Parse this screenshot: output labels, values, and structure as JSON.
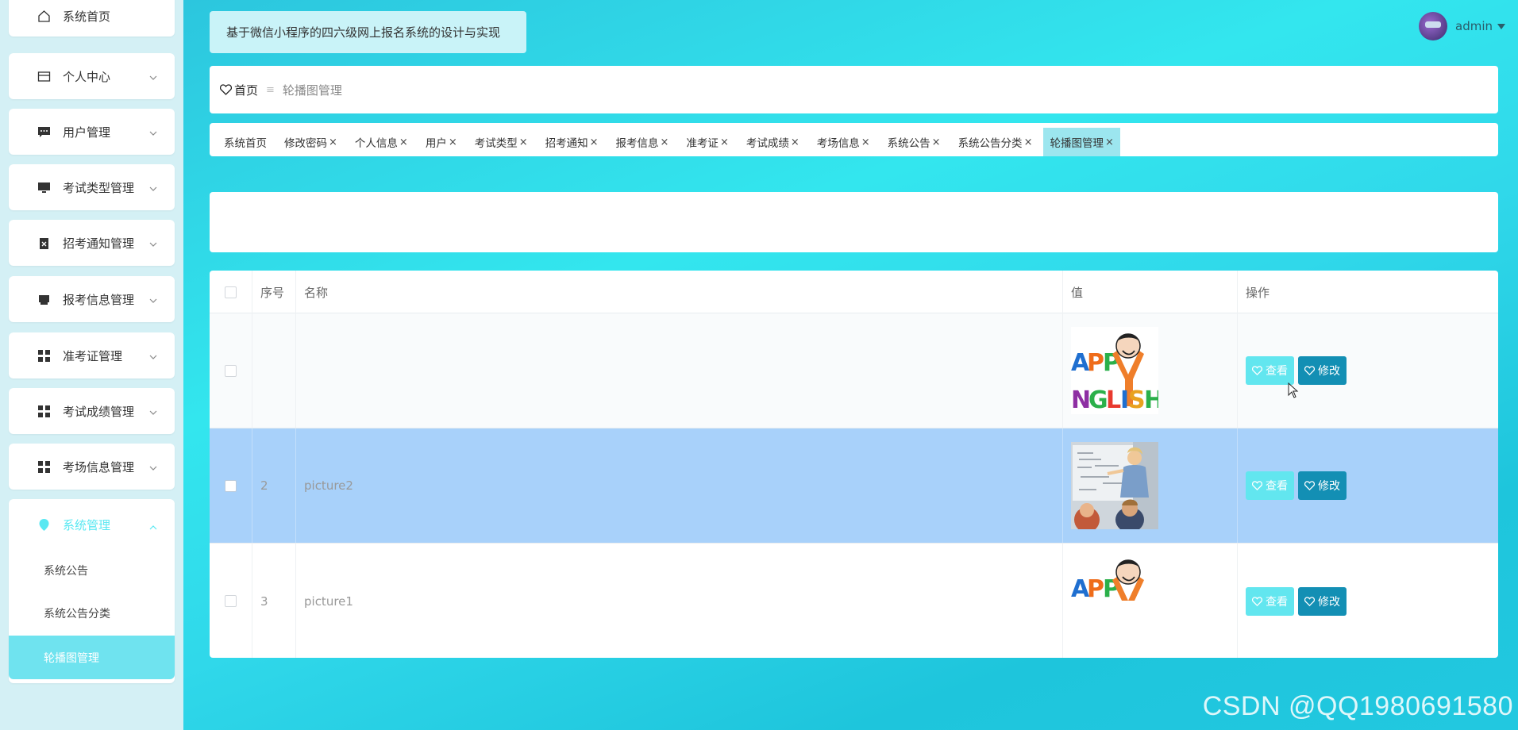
{
  "sidebar": {
    "items": [
      {
        "label": "系统首页",
        "icon": "home-icon"
      },
      {
        "label": "个人中心",
        "icon": "wallet-icon"
      },
      {
        "label": "用户管理",
        "icon": "chat-icon"
      },
      {
        "label": "考试类型管理",
        "icon": "monitor-icon"
      },
      {
        "label": "招考通知管理",
        "icon": "clipboard-icon"
      },
      {
        "label": "报考信息管理",
        "icon": "printer-icon"
      },
      {
        "label": "准考证管理",
        "icon": "grid-icon"
      },
      {
        "label": "考试成绩管理",
        "icon": "grid-icon"
      },
      {
        "label": "考场信息管理",
        "icon": "grid-icon"
      },
      {
        "label": "系统管理",
        "icon": "location-icon"
      }
    ],
    "sub_items": [
      "系统公告",
      "系统公告分类",
      "轮播图管理"
    ]
  },
  "header": {
    "title": "基于微信小程序的四六级网上报名系统的设计与实现",
    "user": "admin"
  },
  "breadcrumb": {
    "home": "首页",
    "separator": "≡",
    "current": "轮播图管理"
  },
  "tabs": [
    {
      "label": "系统首页",
      "closable": false
    },
    {
      "label": "修改密码",
      "closable": true
    },
    {
      "label": "个人信息",
      "closable": true
    },
    {
      "label": "用户",
      "closable": true
    },
    {
      "label": "考试类型",
      "closable": true
    },
    {
      "label": "招考通知",
      "closable": true
    },
    {
      "label": "报考信息",
      "closable": true
    },
    {
      "label": "准考证",
      "closable": true
    },
    {
      "label": "考试成绩",
      "closable": true
    },
    {
      "label": "考场信息",
      "closable": true
    },
    {
      "label": "系统公告",
      "closable": true
    },
    {
      "label": "系统公告分类",
      "closable": true
    },
    {
      "label": "轮播图管理",
      "closable": true
    }
  ],
  "tab_close_glyph": "×",
  "table": {
    "headers": {
      "index": "序号",
      "name": "名称",
      "value": "值",
      "actions": "操作"
    },
    "rows": [
      {
        "index": "",
        "name": "",
        "image": "happy-english-cartoon"
      },
      {
        "index": "2",
        "name": "picture2",
        "image": "teacher-classroom-photo"
      },
      {
        "index": "3",
        "name": "picture1",
        "image": "happy-english-cartoon-cropped"
      }
    ],
    "view_label": "查看",
    "edit_label": "修改"
  },
  "watermark": "CSDN @QQ1980691580",
  "colors": {
    "accent": "#59e8f2",
    "view_button": "#62e6ef",
    "edit_button": "#138fb4",
    "selected_row": "#a8d1fa"
  }
}
